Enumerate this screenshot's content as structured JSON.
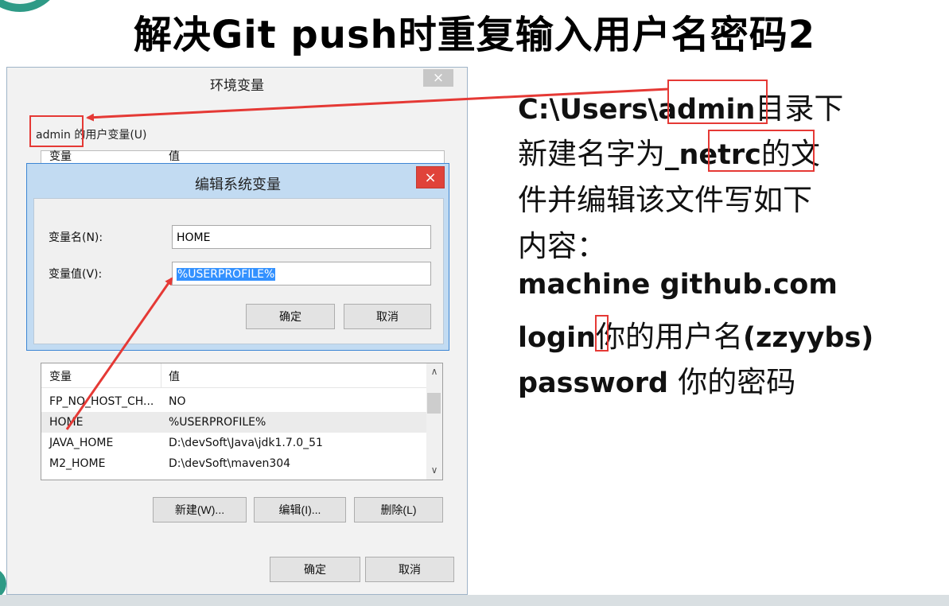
{
  "slide": {
    "title": "解决Git push时重复输入用户名密码2"
  },
  "env_window": {
    "title": "环境变量",
    "close": "×",
    "user_vars_label": "admin 的用户变量(U)",
    "ghost_header": {
      "var": "变量",
      "val": "值"
    },
    "system_vars": {
      "header": {
        "var": "变量",
        "val": "值"
      },
      "rows": [
        {
          "name": "FP_NO_HOST_CH...",
          "value": "NO"
        },
        {
          "name": "HOME",
          "value": "%USERPROFILE%"
        },
        {
          "name": "JAVA_HOME",
          "value": "D:\\devSoft\\Java\\jdk1.7.0_51"
        },
        {
          "name": "M2_HOME",
          "value": "D:\\devSoft\\maven304"
        }
      ]
    },
    "buttons": {
      "new": "新建(W)...",
      "edit": "编辑(I)...",
      "delete": "删除(L)",
      "ok": "确定",
      "cancel": "取消"
    }
  },
  "edit_dialog": {
    "title": "编辑系统变量",
    "close": "×",
    "name_label": "变量名(N):",
    "name_value": "HOME",
    "value_label": "变量值(V):",
    "value_value": "%USERPROFILE%",
    "ok": "确定",
    "cancel": "取消"
  },
  "notes": {
    "l1a": "C:\\Users\\",
    "l1b": "admin",
    "l1c": "目录下",
    "l2a": "新建名字为",
    "l2b": "_netrc",
    "l2c": "的文",
    "l3": "件并编辑该文件写如下",
    "l4": "内容：",
    "l5": "machine github.com",
    "l6a": "login",
    "l6b": "你的用户名",
    "l6c": "(zzyybs)",
    "l7a": "password ",
    "l7b": "你的密码"
  },
  "colors": {
    "accent_red": "#e53935",
    "selection_blue": "#3391ff",
    "dialog_border": "#3d86d4",
    "corner_teal": "#2e9a86"
  },
  "icons": [
    "close-icon",
    "scroll-up-icon",
    "scroll-down-icon"
  ]
}
